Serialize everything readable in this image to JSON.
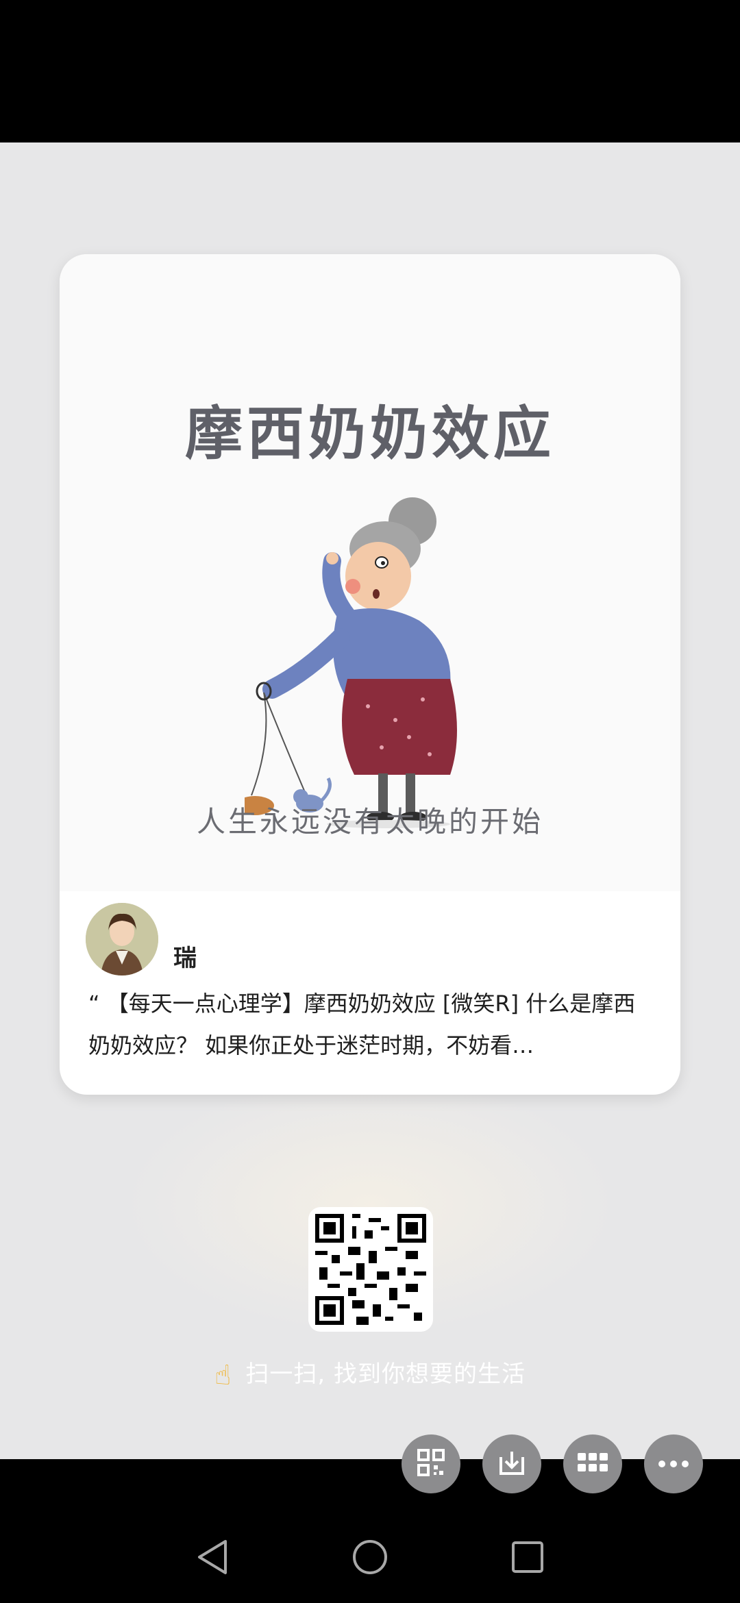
{
  "card": {
    "title": "摩西奶奶效应",
    "subtitle": "人生永远没有太晚的开始",
    "author_name": "瑞",
    "excerpt": "“ 【每天一点心理学】摩西奶奶效应 [微笑R] 什么是摩西奶奶效应？ 如果你正处于迷茫时期，不妨看…"
  },
  "qr": {
    "caption": "扫一扫, 找到你想要的生活"
  },
  "actions": [
    {
      "icon": "qr-code-icon"
    },
    {
      "icon": "download-icon"
    },
    {
      "icon": "grid-icon"
    },
    {
      "icon": "more-icon"
    }
  ],
  "navigation": [
    {
      "icon": "back-triangle-icon"
    },
    {
      "icon": "home-circle-icon"
    },
    {
      "icon": "recents-square-icon"
    }
  ],
  "colors": {
    "background": "#e7e7e8",
    "card": "#ffffff",
    "action_button": "#8c8c8e",
    "title_text": "#5f6068"
  }
}
